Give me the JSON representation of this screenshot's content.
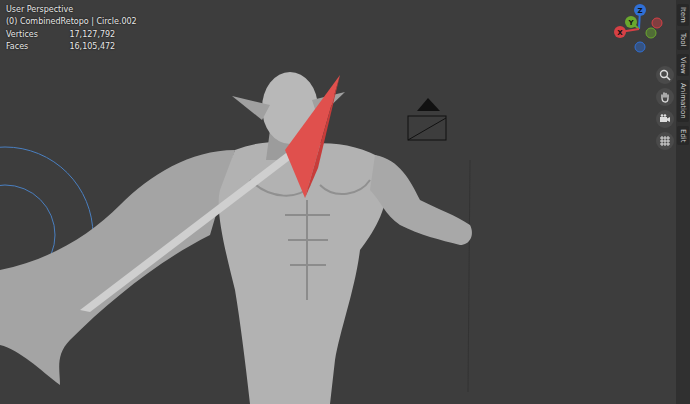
{
  "viewport": {
    "view_name": "User Perspective",
    "object_info": "(0) CombinedRetopo | Circle.002",
    "stats": [
      {
        "label": "Vertices",
        "value": "17,127,792"
      },
      {
        "label": "Faces",
        "value": "16,105,472"
      }
    ]
  },
  "gizmo": {
    "axes": [
      {
        "label": "Z",
        "color": "#2f6fd6"
      },
      {
        "label": "Y",
        "color": "#6aa82e"
      },
      {
        "label": "X",
        "color": "#d64045"
      }
    ]
  },
  "sidebar_tabs": [
    "Item",
    "Tool",
    "View",
    "Animation",
    "Edit"
  ]
}
